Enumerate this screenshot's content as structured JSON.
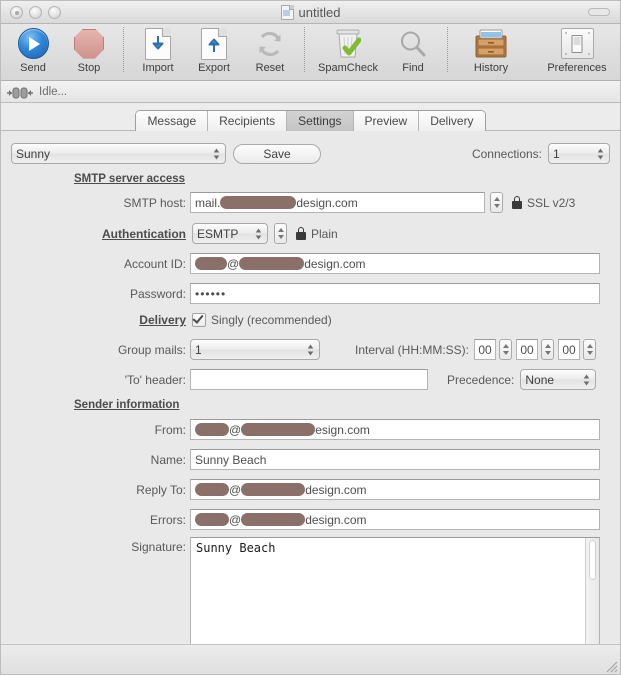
{
  "window": {
    "title": "untitled",
    "document_icon": "document-icon",
    "traffic_lights": [
      "close-button",
      "minimize-button",
      "zoom-button"
    ]
  },
  "toolbar": {
    "items": [
      {
        "label": "Send",
        "icon": "play-circle-icon"
      },
      {
        "label": "Stop",
        "icon": "stop-octagon-icon"
      },
      {
        "label": "Import",
        "icon": "page-download-arrow-icon"
      },
      {
        "label": "Export",
        "icon": "page-upload-arrow-icon"
      },
      {
        "label": "Reset",
        "icon": "refresh-cycle-icon"
      },
      {
        "label": "SpamCheck",
        "icon": "trash-checkmark-icon"
      },
      {
        "label": "Find",
        "icon": "magnifier-icon"
      },
      {
        "label": "History",
        "icon": "file-drawer-icon"
      },
      {
        "label": "Preferences",
        "icon": "light-switch-icon"
      }
    ]
  },
  "status": {
    "icon": "network-plug-icon",
    "text": "Idle..."
  },
  "tabs": {
    "items": [
      "Message",
      "Recipients",
      "Settings",
      "Preview",
      "Delivery"
    ],
    "active": "Settings"
  },
  "settings": {
    "profile": {
      "selected": "Sunny",
      "save_label": "Save"
    },
    "connections": {
      "label": "Connections:",
      "value": "1"
    },
    "smtp_section": {
      "heading": "SMTP server access",
      "smtp_host": {
        "label": "SMTP host:",
        "prefix": "mail.",
        "suffix": "design.com",
        "redacted": true
      },
      "ssl": {
        "label": "SSL v2/3",
        "icon": "lock-icon"
      },
      "authentication": {
        "label": "Authentication",
        "method": "ESMTP",
        "security": "Plain",
        "security_icon": "lock-icon"
      },
      "account_id": {
        "label": "Account ID:",
        "at": "@",
        "suffix": "design.com",
        "redacted": true
      },
      "password": {
        "label": "Password:",
        "value": "••••••"
      }
    },
    "delivery_section": {
      "label": "Delivery",
      "singly": {
        "label": "Singly (recommended)",
        "checked": true
      },
      "group_mails": {
        "label": "Group mails:",
        "value": "1"
      },
      "interval": {
        "label": "Interval (HH:MM:SS):",
        "hours": "00",
        "minutes": "00",
        "seconds": "00"
      },
      "to_header": {
        "label": "'To' header:",
        "value": ""
      },
      "precedence": {
        "label": "Precedence:",
        "value": "None"
      }
    },
    "sender_section": {
      "heading": "Sender information",
      "from": {
        "label": "From:",
        "at": "@",
        "suffix": "esign.com",
        "redacted": true
      },
      "name": {
        "label": "Name:",
        "value": "Sunny Beach"
      },
      "reply_to": {
        "label": "Reply To:",
        "at": "@",
        "suffix": "design.com",
        "redacted": true
      },
      "errors": {
        "label": "Errors:",
        "at": "@",
        "suffix": "design.com",
        "redacted": true
      },
      "signature": {
        "label": "Signature:",
        "value": "Sunny Beach"
      }
    }
  },
  "colors": {
    "redaction": "#8a7068",
    "accent_blue": "#2f86db",
    "stop_red": "#cf938c",
    "window_bg": "#e9e9e9"
  }
}
